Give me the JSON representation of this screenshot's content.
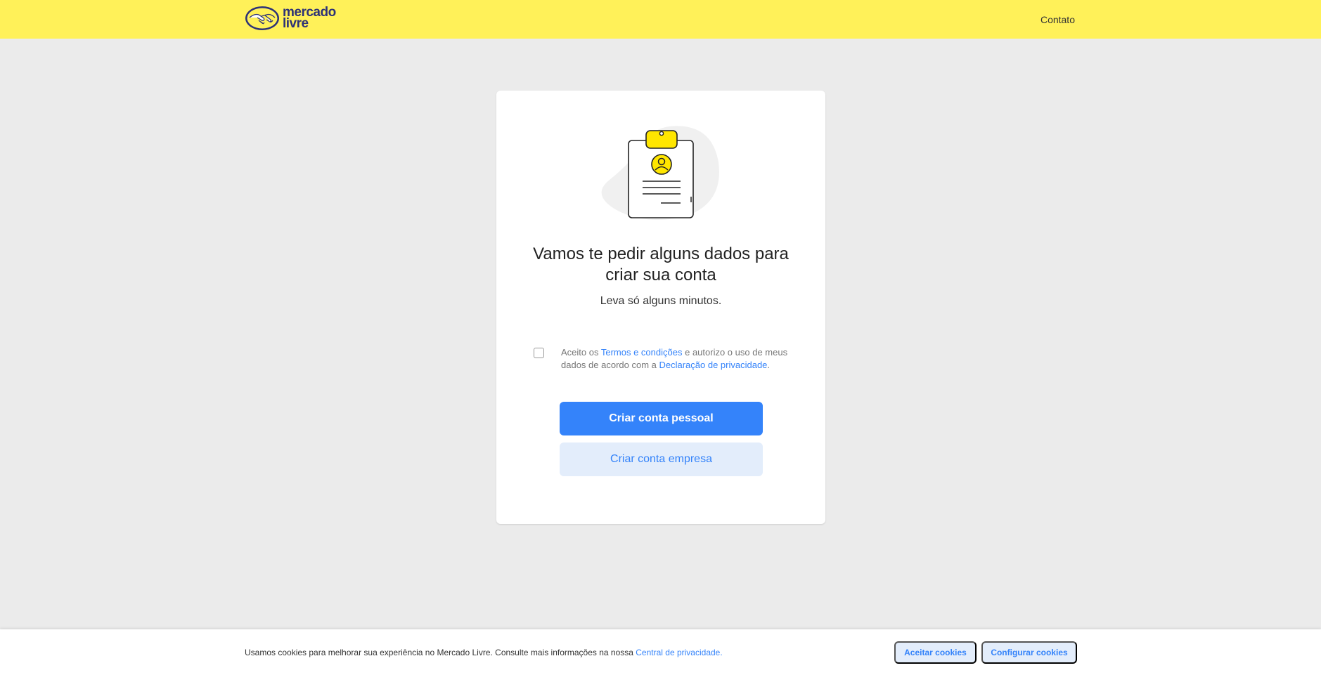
{
  "header": {
    "logo_line1": "mercado",
    "logo_line2": "livre",
    "contact_label": "Contato"
  },
  "main": {
    "title": "Vamos te pedir alguns dados para criar sua conta",
    "subtitle": "Leva só alguns minutos.",
    "terms": {
      "prefix": "Aceito os ",
      "terms_link": "Termos e condições",
      "middle": " e autorizo o uso de meus dados de acordo com a ",
      "privacy_link": "Declaração de privacidade",
      "suffix": "."
    },
    "personal_button": "Criar conta pessoal",
    "business_button": "Criar conta empresa"
  },
  "cookie_bar": {
    "text": "Usamos cookies para melhorar sua experiência no Mercado Livre. Consulte mais informações na nossa ",
    "link": "Central de privacidade.",
    "accept_button": "Aceitar cookies",
    "configure_button": "Configurar cookies"
  },
  "colors": {
    "brand_yellow": "#fff159",
    "accent_blue": "#3483fa",
    "brand_navy": "#2d3277"
  },
  "icons": [
    "mercado-livre-handshake-icon",
    "clipboard-profile-illustration"
  ]
}
